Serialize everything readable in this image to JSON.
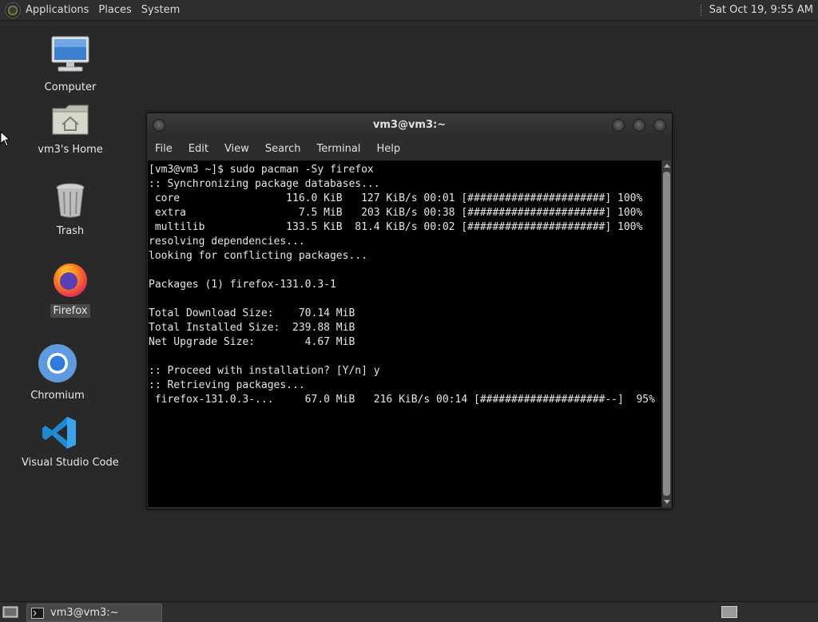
{
  "top_panel": {
    "menus": [
      "Applications",
      "Places",
      "System"
    ],
    "clock": "Sat Oct 19,  9:55 AM"
  },
  "desktop": {
    "icons": [
      {
        "label": "Computer",
        "icon": "computer-icon"
      },
      {
        "label": "vm3's Home",
        "icon": "home-folder-icon"
      },
      {
        "label": "Trash",
        "icon": "trash-icon"
      },
      {
        "label": "Firefox",
        "icon": "firefox-icon",
        "selected": true
      },
      {
        "label": "Chromium",
        "icon": "chromium-icon"
      },
      {
        "label": "Visual Studio Code",
        "icon": "vscode-icon"
      }
    ]
  },
  "terminal": {
    "title": "vm3@vm3:~",
    "menu": [
      "File",
      "Edit",
      "View",
      "Search",
      "Terminal",
      "Help"
    ],
    "lines": [
      "[vm3@vm3 ~]$ sudo pacman -Sy firefox",
      ":: Synchronizing package databases...",
      " core                 116.0 KiB   127 KiB/s 00:01 [######################] 100%",
      " extra                  7.5 MiB   203 KiB/s 00:38 [######################] 100%",
      " multilib             133.5 KiB  81.4 KiB/s 00:02 [######################] 100%",
      "resolving dependencies...",
      "looking for conflicting packages...",
      "",
      "Packages (1) firefox-131.0.3-1",
      "",
      "Total Download Size:    70.14 MiB",
      "Total Installed Size:  239.88 MiB",
      "Net Upgrade Size:        4.67 MiB",
      "",
      ":: Proceed with installation? [Y/n] y",
      ":: Retrieving packages...",
      " firefox-131.0.3-...     67.0 MiB   216 KiB/s 00:14 [####################--]  95%"
    ]
  },
  "taskbar": {
    "window_button": "vm3@vm3:~"
  }
}
